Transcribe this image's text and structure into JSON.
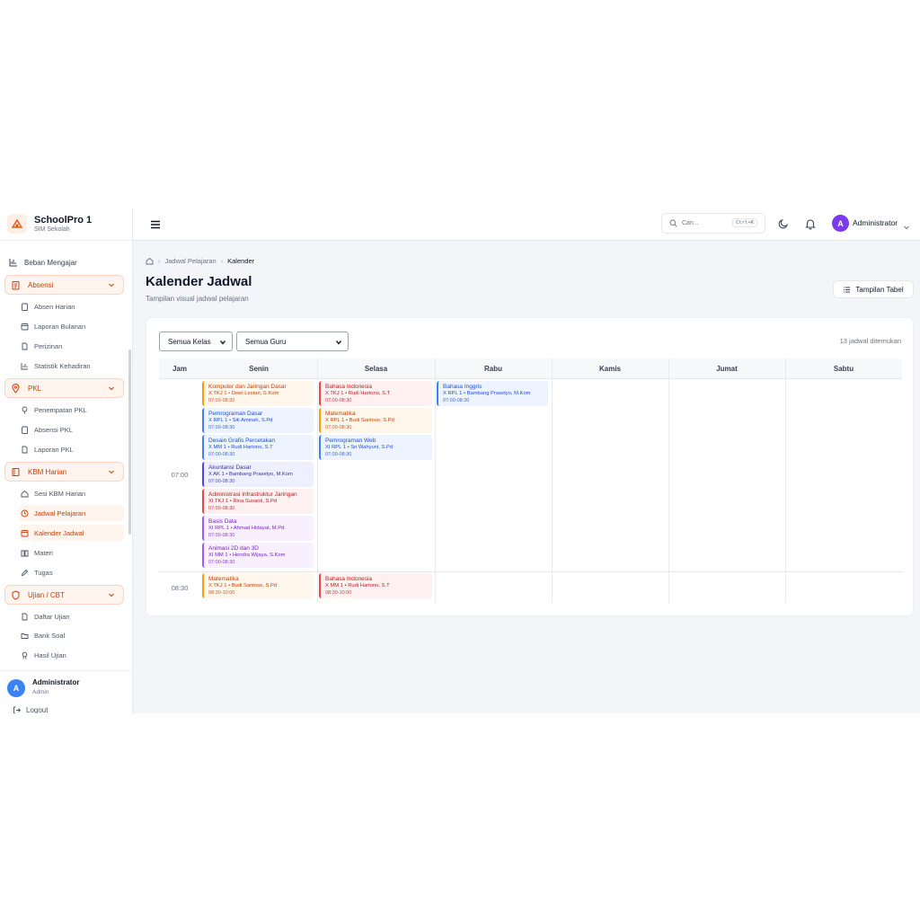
{
  "brand": {
    "title": "SchoolPro 1",
    "subtitle": "SIM Sekolah"
  },
  "sidebar": {
    "top_item": "Beban Mengajar",
    "groups": [
      {
        "label": "Absensi",
        "items": [
          "Absen Harian",
          "Laporan Bulanan",
          "Perizinan",
          "Statistik Kehadiran"
        ]
      },
      {
        "label": "PKL",
        "items": [
          "Penempatan PKL",
          "Absensi PKL",
          "Laporan PKL"
        ]
      },
      {
        "label": "KBM Harian",
        "items": [
          "Sesi KBM Harian",
          "Jadwal Pelajaran",
          "Kalender Jadwal",
          "Materi",
          "Tugas"
        ]
      },
      {
        "label": "Ujian / CBT",
        "items": [
          "Daftar Ujian",
          "Bank Soal",
          "Hasil Ujian"
        ]
      }
    ],
    "user": {
      "initial": "A",
      "name": "Administrator",
      "role": "Admin",
      "logout": "Logout"
    }
  },
  "header": {
    "search_placeholder": "Cari...",
    "shortcut": "Ctrl+K",
    "avatar_initial": "A",
    "user_name": "Administrator"
  },
  "breadcrumb": {
    "parent": "Jadwal Pelajaran",
    "current": "Kalender"
  },
  "page": {
    "title": "Kalender Jadwal",
    "subtitle": "Tampilan visual jadwal pelajaran",
    "table_view_button": "Tampilan Tabel"
  },
  "filters": {
    "class": "Semua Kelas",
    "teacher": "Semua Guru",
    "count_text": "13 jadwal ditemukan"
  },
  "calendar": {
    "time_header": "Jam",
    "days": [
      "Senin",
      "Selasa",
      "Rabu",
      "Kamis",
      "Jumat",
      "Sabtu"
    ],
    "slots": [
      "07:00",
      "08:30"
    ],
    "events": {
      "senin_0700": [
        {
          "title": "Komputer dan Jaringan Dasar",
          "detail": "X TKJ 1 • Dewi Lestari, S.Kom",
          "time": "07:00-08:30",
          "color": "orange"
        },
        {
          "title": "Pemrograman Dasar",
          "detail": "X RPL 1 • Siti Aminah, S.Pd",
          "time": "07:00-08:30",
          "color": "blue"
        },
        {
          "title": "Desain Grafis Percetakan",
          "detail": "X MM 1 • Rudi Hartono, S.T",
          "time": "07:00-08:30",
          "color": "blue"
        },
        {
          "title": "Akuntansi Dasar",
          "detail": "X AK 1 • Bambang Prasetyo, M.Kom",
          "time": "07:00-08:30",
          "color": "indigo"
        },
        {
          "title": "Administrasi Infrastruktur Jaringan",
          "detail": "XI TKJ 1 • Rina Susanti, S.Pd",
          "time": "07:00-08:30",
          "color": "red"
        },
        {
          "title": "Basis Data",
          "detail": "XI RPL 1 • Ahmad Hidayat, M.Pd",
          "time": "07:00-08:30",
          "color": "purple"
        },
        {
          "title": "Animasi 2D dan 3D",
          "detail": "XI MM 1 • Hendra Wijaya, S.Kom",
          "time": "07:00-08:30",
          "color": "purple"
        }
      ],
      "selasa_0700": [
        {
          "title": "Bahasa Indonesia",
          "detail": "X TKJ 1 • Rudi Hartono, S.T",
          "time": "07:00-08:30",
          "color": "red"
        },
        {
          "title": "Matematika",
          "detail": "X RPL 1 • Budi Santoso, S.Pd",
          "time": "07:00-08:30",
          "color": "orange"
        },
        {
          "title": "Pemrograman Web",
          "detail": "XI RPL 1 • Sri Wahyuni, S.Pd",
          "time": "07:00-08:30",
          "color": "blue"
        }
      ],
      "rabu_0700": [
        {
          "title": "Bahasa Inggris",
          "detail": "X RPL 1 • Bambang Prasetyo, M.Kom",
          "time": "07:00-08:30",
          "color": "blue"
        }
      ],
      "senin_0830": [
        {
          "title": "Matematika",
          "detail": "X TKJ 1 • Budi Santoso, S.Pd",
          "time": "08:30-10:00",
          "color": "orange"
        }
      ],
      "selasa_0830": [
        {
          "title": "Bahasa Indonesia",
          "detail": "X MM 1 • Rudi Hartono, S.T",
          "time": "08:30-10:00",
          "color": "red"
        }
      ]
    }
  }
}
